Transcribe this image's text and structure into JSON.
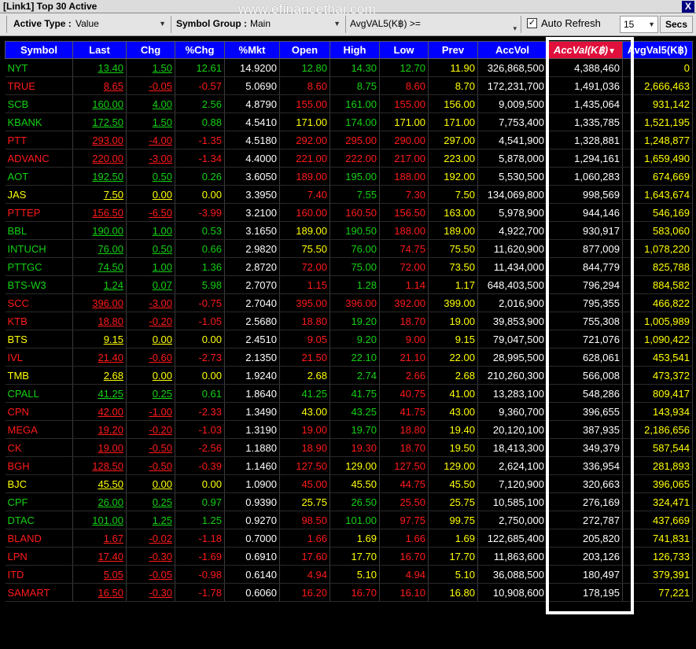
{
  "window": {
    "title": "[Link1] Top 30 Active",
    "watermark": "www.efinancethai.com",
    "close_label": "X"
  },
  "toolbar": {
    "active_type_label": "Active Type :",
    "active_type_value": "Value",
    "symbol_group_label": "Symbol Group :",
    "symbol_group_value": "Main",
    "filter_label": "AvgVAL5(K฿) >=",
    "auto_refresh_label": "Auto Refresh",
    "auto_refresh_checked": "✓",
    "refresh_interval": "15",
    "secs_label": "Secs"
  },
  "columns": [
    "Symbol",
    "Last",
    "Chg",
    "%Chg",
    "%Mkt",
    "Open",
    "High",
    "Low",
    "Prev",
    "AccVol",
    "AccVal(K฿)",
    "AvgVal5(K฿)"
  ],
  "active_sort_column": "AccVal(K฿)",
  "colors": {
    "up": "#13d113",
    "down": "#ff1a1a",
    "unchanged": "#ffff00",
    "header_bg": "#0000ff",
    "sorted_header_bg": "#e0103c"
  },
  "rows": [
    {
      "symbol": "NYT",
      "last": "13.40",
      "chg": "1.50",
      "pchg": "12.61",
      "pmkt": "14.9200",
      "open": "12.80",
      "high": "14.30",
      "low": "12.70",
      "prev": "11.90",
      "accvol": "326,868,500",
      "accval": "4,388,460",
      "avgval5": "0",
      "st": "up",
      "os": "up",
      "hs": "up",
      "ls": "up"
    },
    {
      "symbol": "TRUE",
      "last": "8.65",
      "chg": "-0.05",
      "pchg": "-0.57",
      "pmkt": "5.0690",
      "open": "8.60",
      "high": "8.75",
      "low": "8.60",
      "prev": "8.70",
      "accvol": "172,231,700",
      "accval": "1,491,036",
      "avgval5": "2,666,463",
      "st": "down",
      "os": "down",
      "hs": "up",
      "ls": "down"
    },
    {
      "symbol": "SCB",
      "last": "160.00",
      "chg": "4.00",
      "pchg": "2.56",
      "pmkt": "4.8790",
      "open": "155.00",
      "high": "161.00",
      "low": "155.00",
      "prev": "156.00",
      "accvol": "9,009,500",
      "accval": "1,435,064",
      "avgval5": "931,142",
      "st": "up",
      "os": "down",
      "hs": "up",
      "ls": "down"
    },
    {
      "symbol": "KBANK",
      "last": "172.50",
      "chg": "1.50",
      "pchg": "0.88",
      "pmkt": "4.5410",
      "open": "171.00",
      "high": "174.00",
      "low": "171.00",
      "prev": "171.00",
      "accvol": "7,753,400",
      "accval": "1,335,785",
      "avgval5": "1,521,195",
      "st": "up",
      "os": "flat",
      "hs": "up",
      "ls": "flat"
    },
    {
      "symbol": "PTT",
      "last": "293.00",
      "chg": "-4.00",
      "pchg": "-1.35",
      "pmkt": "4.5180",
      "open": "292.00",
      "high": "295.00",
      "low": "290.00",
      "prev": "297.00",
      "accvol": "4,541,900",
      "accval": "1,328,881",
      "avgval5": "1,248,877",
      "st": "down",
      "os": "down",
      "hs": "down",
      "ls": "down"
    },
    {
      "symbol": "ADVANC",
      "last": "220.00",
      "chg": "-3.00",
      "pchg": "-1.34",
      "pmkt": "4.4000",
      "open": "221.00",
      "high": "222.00",
      "low": "217.00",
      "prev": "223.00",
      "accvol": "5,878,000",
      "accval": "1,294,161",
      "avgval5": "1,659,490",
      "st": "down",
      "os": "down",
      "hs": "down",
      "ls": "down"
    },
    {
      "symbol": "AOT",
      "last": "192.50",
      "chg": "0.50",
      "pchg": "0.26",
      "pmkt": "3.6050",
      "open": "189.00",
      "high": "195.00",
      "low": "188.00",
      "prev": "192.00",
      "accvol": "5,530,500",
      "accval": "1,060,283",
      "avgval5": "674,669",
      "st": "up",
      "os": "down",
      "hs": "up",
      "ls": "down"
    },
    {
      "symbol": "JAS",
      "last": "7.50",
      "chg": "0.00",
      "pchg": "0.00",
      "pmkt": "3.3950",
      "open": "7.40",
      "high": "7.55",
      "low": "7.30",
      "prev": "7.50",
      "accvol": "134,069,800",
      "accval": "998,569",
      "avgval5": "1,643,674",
      "st": "flat",
      "os": "down",
      "hs": "up",
      "ls": "down"
    },
    {
      "symbol": "PTTEP",
      "last": "156.50",
      "chg": "-6.50",
      "pchg": "-3.99",
      "pmkt": "3.2100",
      "open": "160.00",
      "high": "160.50",
      "low": "156.50",
      "prev": "163.00",
      "accvol": "5,978,900",
      "accval": "944,146",
      "avgval5": "546,169",
      "st": "down",
      "os": "down",
      "hs": "down",
      "ls": "down"
    },
    {
      "symbol": "BBL",
      "last": "190.00",
      "chg": "1.00",
      "pchg": "0.53",
      "pmkt": "3.1650",
      "open": "189.00",
      "high": "190.50",
      "low": "188.00",
      "prev": "189.00",
      "accvol": "4,922,700",
      "accval": "930,917",
      "avgval5": "583,060",
      "st": "up",
      "os": "flat",
      "hs": "up",
      "ls": "down"
    },
    {
      "symbol": "INTUCH",
      "last": "76.00",
      "chg": "0.50",
      "pchg": "0.66",
      "pmkt": "2.9820",
      "open": "75.50",
      "high": "76.00",
      "low": "74.75",
      "prev": "75.50",
      "accvol": "11,620,900",
      "accval": "877,009",
      "avgval5": "1,078,220",
      "st": "up",
      "os": "flat",
      "hs": "up",
      "ls": "down"
    },
    {
      "symbol": "PTTGC",
      "last": "74.50",
      "chg": "1.00",
      "pchg": "1.36",
      "pmkt": "2.8720",
      "open": "72.00",
      "high": "75.00",
      "low": "72.00",
      "prev": "73.50",
      "accvol": "11,434,000",
      "accval": "844,779",
      "avgval5": "825,788",
      "st": "up",
      "os": "down",
      "hs": "up",
      "ls": "down"
    },
    {
      "symbol": "BTS-W3",
      "last": "1.24",
      "chg": "0.07",
      "pchg": "5.98",
      "pmkt": "2.7070",
      "open": "1.15",
      "high": "1.28",
      "low": "1.14",
      "prev": "1.17",
      "accvol": "648,403,500",
      "accval": "796,294",
      "avgval5": "884,582",
      "st": "up",
      "os": "down",
      "hs": "up",
      "ls": "down"
    },
    {
      "symbol": "SCC",
      "last": "396.00",
      "chg": "-3.00",
      "pchg": "-0.75",
      "pmkt": "2.7040",
      "open": "395.00",
      "high": "396.00",
      "low": "392.00",
      "prev": "399.00",
      "accvol": "2,016,900",
      "accval": "795,355",
      "avgval5": "466,822",
      "st": "down",
      "os": "down",
      "hs": "down",
      "ls": "down"
    },
    {
      "symbol": "KTB",
      "last": "18.80",
      "chg": "-0.20",
      "pchg": "-1.05",
      "pmkt": "2.5680",
      "open": "18.80",
      "high": "19.20",
      "low": "18.70",
      "prev": "19.00",
      "accvol": "39,853,900",
      "accval": "755,308",
      "avgval5": "1,005,989",
      "st": "down",
      "os": "down",
      "hs": "up",
      "ls": "down"
    },
    {
      "symbol": "BTS",
      "last": "9.15",
      "chg": "0.00",
      "pchg": "0.00",
      "pmkt": "2.4510",
      "open": "9.05",
      "high": "9.20",
      "low": "9.00",
      "prev": "9.15",
      "accvol": "79,047,500",
      "accval": "721,076",
      "avgval5": "1,090,422",
      "st": "flat",
      "os": "down",
      "hs": "up",
      "ls": "down"
    },
    {
      "symbol": "IVL",
      "last": "21.40",
      "chg": "-0.60",
      "pchg": "-2.73",
      "pmkt": "2.1350",
      "open": "21.50",
      "high": "22.10",
      "low": "21.10",
      "prev": "22.00",
      "accvol": "28,995,500",
      "accval": "628,061",
      "avgval5": "453,541",
      "st": "down",
      "os": "down",
      "hs": "up",
      "ls": "down"
    },
    {
      "symbol": "TMB",
      "last": "2.68",
      "chg": "0.00",
      "pchg": "0.00",
      "pmkt": "1.9240",
      "open": "2.68",
      "high": "2.74",
      "low": "2.66",
      "prev": "2.68",
      "accvol": "210,260,300",
      "accval": "566,008",
      "avgval5": "473,372",
      "st": "flat",
      "os": "flat",
      "hs": "up",
      "ls": "down"
    },
    {
      "symbol": "CPALL",
      "last": "41.25",
      "chg": "0.25",
      "pchg": "0.61",
      "pmkt": "1.8640",
      "open": "41.25",
      "high": "41.75",
      "low": "40.75",
      "prev": "41.00",
      "accvol": "13,283,100",
      "accval": "548,286",
      "avgval5": "809,417",
      "st": "up",
      "os": "up",
      "hs": "up",
      "ls": "down"
    },
    {
      "symbol": "CPN",
      "last": "42.00",
      "chg": "-1.00",
      "pchg": "-2.33",
      "pmkt": "1.3490",
      "open": "43.00",
      "high": "43.25",
      "low": "41.75",
      "prev": "43.00",
      "accvol": "9,360,700",
      "accval": "396,655",
      "avgval5": "143,934",
      "st": "down",
      "os": "flat",
      "hs": "up",
      "ls": "down"
    },
    {
      "symbol": "MEGA",
      "last": "19.20",
      "chg": "-0.20",
      "pchg": "-1.03",
      "pmkt": "1.3190",
      "open": "19.00",
      "high": "19.70",
      "low": "18.80",
      "prev": "19.40",
      "accvol": "20,120,100",
      "accval": "387,935",
      "avgval5": "2,186,656",
      "st": "down",
      "os": "down",
      "hs": "up",
      "ls": "down"
    },
    {
      "symbol": "CK",
      "last": "19.00",
      "chg": "-0.50",
      "pchg": "-2.56",
      "pmkt": "1.1880",
      "open": "18.90",
      "high": "19.30",
      "low": "18.70",
      "prev": "19.50",
      "accvol": "18,413,300",
      "accval": "349,379",
      "avgval5": "587,544",
      "st": "down",
      "os": "down",
      "hs": "down",
      "ls": "down"
    },
    {
      "symbol": "BGH",
      "last": "128.50",
      "chg": "-0.50",
      "pchg": "-0.39",
      "pmkt": "1.1460",
      "open": "127.50",
      "high": "129.00",
      "low": "127.50",
      "prev": "129.00",
      "accvol": "2,624,100",
      "accval": "336,954",
      "avgval5": "281,893",
      "st": "down",
      "os": "down",
      "hs": "flat",
      "ls": "down"
    },
    {
      "symbol": "BJC",
      "last": "45.50",
      "chg": "0.00",
      "pchg": "0.00",
      "pmkt": "1.0900",
      "open": "45.00",
      "high": "45.50",
      "low": "44.75",
      "prev": "45.50",
      "accvol": "7,120,900",
      "accval": "320,663",
      "avgval5": "396,065",
      "st": "flat",
      "os": "down",
      "hs": "flat",
      "ls": "down"
    },
    {
      "symbol": "CPF",
      "last": "26.00",
      "chg": "0.25",
      "pchg": "0.97",
      "pmkt": "0.9390",
      "open": "25.75",
      "high": "26.50",
      "low": "25.50",
      "prev": "25.75",
      "accvol": "10,585,100",
      "accval": "276,169",
      "avgval5": "324,471",
      "st": "up",
      "os": "flat",
      "hs": "up",
      "ls": "down"
    },
    {
      "symbol": "DTAC",
      "last": "101.00",
      "chg": "1.25",
      "pchg": "1.25",
      "pmkt": "0.9270",
      "open": "98.50",
      "high": "101.00",
      "low": "97.75",
      "prev": "99.75",
      "accvol": "2,750,000",
      "accval": "272,787",
      "avgval5": "437,669",
      "st": "up",
      "os": "down",
      "hs": "up",
      "ls": "down"
    },
    {
      "symbol": "BLAND",
      "last": "1.67",
      "chg": "-0.02",
      "pchg": "-1.18",
      "pmkt": "0.7000",
      "open": "1.66",
      "high": "1.69",
      "low": "1.66",
      "prev": "1.69",
      "accvol": "122,685,400",
      "accval": "205,820",
      "avgval5": "741,831",
      "st": "down",
      "os": "down",
      "hs": "flat",
      "ls": "down"
    },
    {
      "symbol": "LPN",
      "last": "17.40",
      "chg": "-0.30",
      "pchg": "-1.69",
      "pmkt": "0.6910",
      "open": "17.60",
      "high": "17.70",
      "low": "16.70",
      "prev": "17.70",
      "accvol": "11,863,600",
      "accval": "203,126",
      "avgval5": "126,733",
      "st": "down",
      "os": "down",
      "hs": "flat",
      "ls": "down"
    },
    {
      "symbol": "ITD",
      "last": "5.05",
      "chg": "-0.05",
      "pchg": "-0.98",
      "pmkt": "0.6140",
      "open": "4.94",
      "high": "5.10",
      "low": "4.94",
      "prev": "5.10",
      "accvol": "36,088,500",
      "accval": "180,497",
      "avgval5": "379,391",
      "st": "down",
      "os": "down",
      "hs": "flat",
      "ls": "down"
    },
    {
      "symbol": "SAMART",
      "last": "16.50",
      "chg": "-0.30",
      "pchg": "-1.78",
      "pmkt": "0.6060",
      "open": "16.20",
      "high": "16.70",
      "low": "16.10",
      "prev": "16.80",
      "accvol": "10,908,600",
      "accval": "178,195",
      "avgval5": "77,221",
      "st": "down",
      "os": "down",
      "hs": "down",
      "ls": "down"
    }
  ]
}
